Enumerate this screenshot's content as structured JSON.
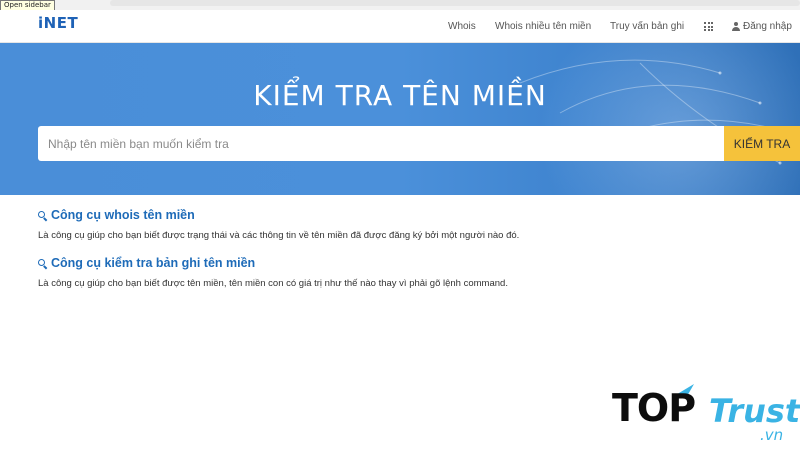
{
  "browser": {
    "tooltip": "Open sidebar"
  },
  "header": {
    "logo": "iNET",
    "nav": [
      {
        "label": "Whois"
      },
      {
        "label": "Whois nhiều tên miền"
      },
      {
        "label": "Truy vấn bản ghi"
      }
    ],
    "apps_icon": "grid-icon",
    "login_label": "Đăng nhập",
    "login_icon": "user-icon"
  },
  "hero": {
    "title": "KIỂM TRA TÊN MIỀN",
    "search_placeholder": "Nhập tên miền bạn muốn kiểm tra",
    "search_value": "",
    "search_button": "KIỂM TRA"
  },
  "tools": [
    {
      "icon": "search-icon",
      "title": "Công cụ whois tên miền",
      "description": "Là công cụ giúp cho bạn biết được trạng thái và các thông tin về tên miền đã được đăng ký bởi một người nào đó."
    },
    {
      "icon": "search-icon",
      "title": "Công cụ kiểm tra bản ghi tên miền",
      "description": "Là công cụ giúp cho bạn biết được tên miền, tên miền con có giá trị như thế nào thay vì phải gõ lệnh command."
    }
  ],
  "watermark": {
    "part1": "TOP",
    "part2": "Trust",
    "part3": ".vn"
  },
  "colors": {
    "hero_blue": "#4a8ed8",
    "accent_yellow": "#f5c23b",
    "link_blue": "#1e6bb8",
    "logo_blue": "#1e62b6"
  }
}
